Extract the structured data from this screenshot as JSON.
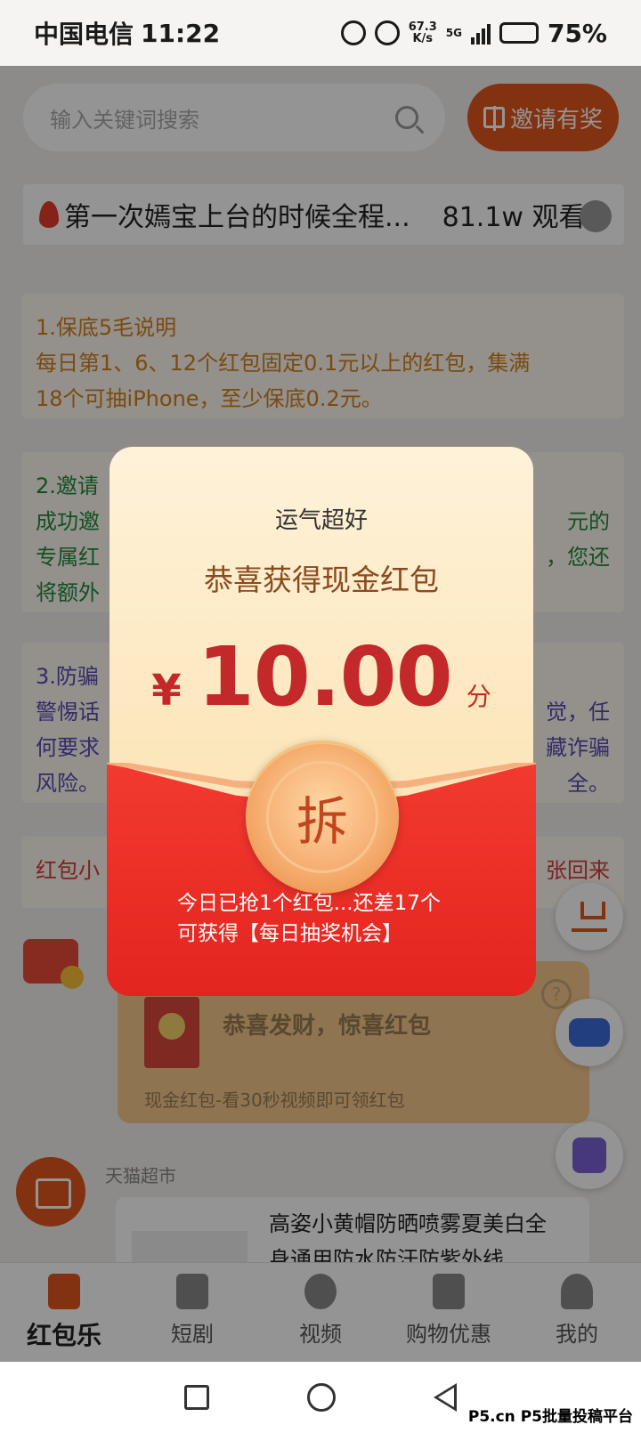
{
  "status": {
    "carrier": "中国电信",
    "time": "11:22",
    "speed_value": "67.3",
    "speed_unit": "K/s",
    "network": "5G",
    "battery": "75%",
    "battery_level": 0.75
  },
  "search": {
    "placeholder": "输入关键词搜索",
    "invite_label": "邀请有奖"
  },
  "hot": {
    "title": "第一次嫣宝上台的时候全程...",
    "views": "81.1w 观看"
  },
  "cards": {
    "c1": {
      "lines": [
        "1.保底5毛说明",
        "每日第1、6、12个红包固定0.1元以上的红包，集满",
        "18个可抽iPhone，至少保底0.2元。"
      ]
    },
    "c2": {
      "lines": [
        "2.邀请",
        "成功邀",
        "专属红",
        "将额外"
      ],
      "right": [
        "元的",
        "，您还"
      ]
    },
    "c3": {
      "lines": [
        "3.防骗",
        "警惕话",
        "何要求",
        "风险。"
      ],
      "right": [
        "觉，任",
        "藏诈骗",
        "全。"
      ]
    },
    "c4": {
      "left": "红包小",
      "right": "张回来"
    }
  },
  "video_packet": {
    "title": "恭喜发财，惊喜红包",
    "subtitle": "现金红包-看30秒视频即可领红包",
    "help": "?"
  },
  "tmall": {
    "label": "天猫超市",
    "desc_line1": "高姿小黄帽防晒喷雾夏美白全",
    "desc_line2": "身通用防水防汗防紫外线"
  },
  "modal": {
    "luck": "运气超好",
    "congrats": "恭喜获得现金红包",
    "currency": "¥",
    "amount": "10.00",
    "unit": "分",
    "open_label": "拆",
    "tip_line1": "今日已抢1个红包...还差17个",
    "tip_line2": "可获得【每日抽奖机会】"
  },
  "tabs": [
    {
      "label": "红包乐",
      "active": true
    },
    {
      "label": "短剧"
    },
    {
      "label": "视频"
    },
    {
      "label": "购物优惠"
    },
    {
      "label": "我的"
    }
  ],
  "watermark": "P5.cn P5批量投稿平台",
  "colors": {
    "accent": "#e0571c",
    "modal_red": "#e3251f",
    "amount_red": "#c3282b"
  }
}
